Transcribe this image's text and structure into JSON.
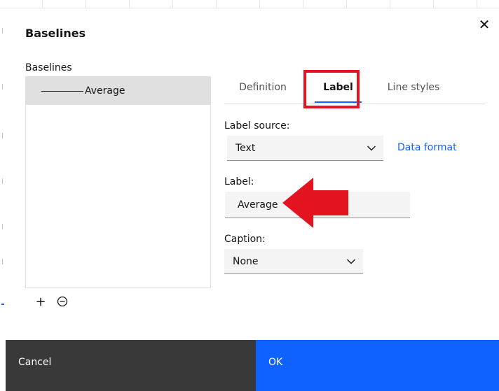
{
  "dialog": {
    "title": "Baselines",
    "close_icon": "close-icon",
    "ok_label": "OK",
    "cancel_label": "Cancel"
  },
  "baselines": {
    "heading": "Baselines",
    "items": [
      {
        "label": "Average"
      }
    ],
    "add_icon": "plus-icon",
    "remove_icon": "minus-circle-icon"
  },
  "tabs": [
    {
      "label": "Definition"
    },
    {
      "label": "Label",
      "selected": true
    },
    {
      "label": "Line styles"
    }
  ],
  "form": {
    "label_source_label": "Label source:",
    "label_source_value": "Text",
    "data_format_link": "Data format",
    "label_label": "Label:",
    "label_value": "Average",
    "caption_label": "Caption:",
    "caption_value": "None"
  },
  "colors": {
    "accent": "#0f62fe",
    "highlight": "#e3141f",
    "cancel_bg": "#393939"
  }
}
